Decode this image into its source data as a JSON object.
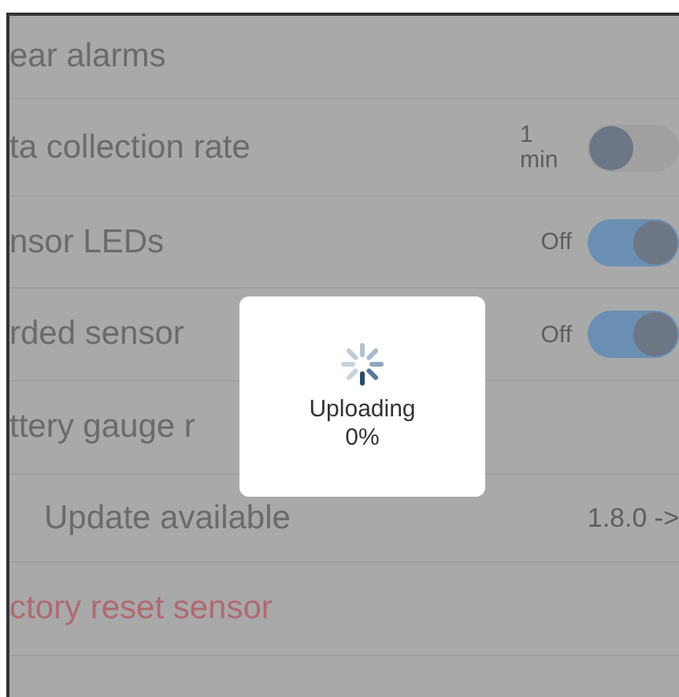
{
  "settings_rows": [
    {
      "kind": "plain",
      "label": "ear alarms"
    },
    {
      "kind": "toggle",
      "label": "ta collection rate",
      "value": "1 min",
      "on": false
    },
    {
      "kind": "toggle",
      "label": "nsor LEDs",
      "value": "Off",
      "on": true
    },
    {
      "kind": "toggle",
      "label": "rded sensor",
      "value": "Off",
      "on": true
    },
    {
      "kind": "plain",
      "label": "ttery gauge r"
    },
    {
      "kind": "update",
      "label": "Update available",
      "value": "1.8.0 ->"
    },
    {
      "kind": "danger",
      "label": "ctory reset sensor"
    }
  ],
  "progress_dialog": {
    "message": "Uploading",
    "progress": "0%"
  }
}
